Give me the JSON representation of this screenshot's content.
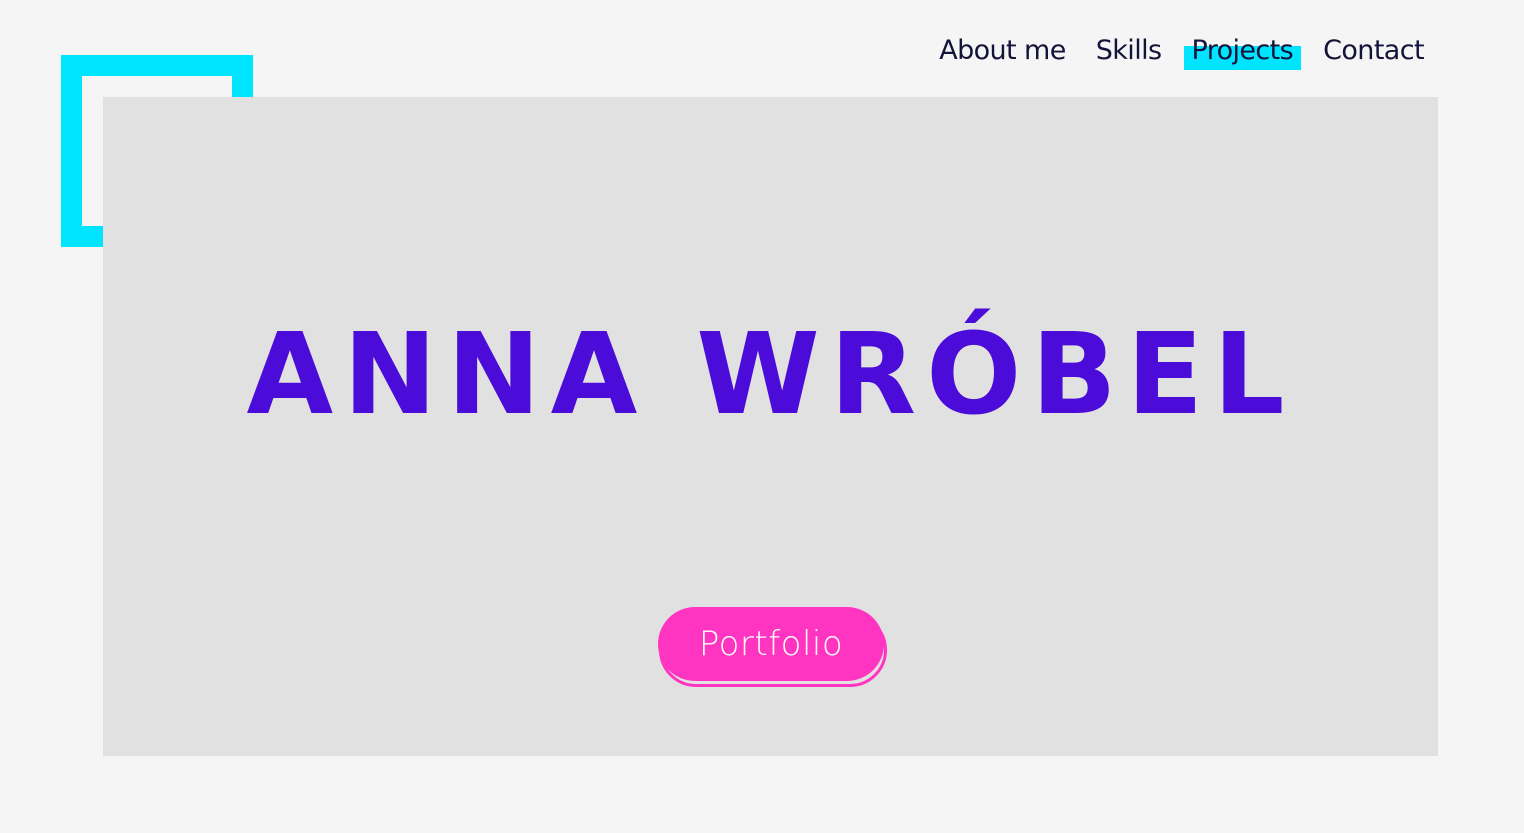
{
  "nav": {
    "items": [
      {
        "label": "About me",
        "active": false
      },
      {
        "label": "Skills",
        "active": false
      },
      {
        "label": "Projects",
        "active": true
      },
      {
        "label": "Contact",
        "active": false
      }
    ]
  },
  "hero": {
    "title": "ANNA WRÓBEL",
    "button_label": "Portfolio"
  },
  "colors": {
    "background": "#f5f5f5",
    "hero_panel": "#e1e1e1",
    "accent_cyan": "#00e5ff",
    "title_violet": "#4b0bd9",
    "button_pink": "#ff35c2",
    "nav_text": "#14143a"
  }
}
